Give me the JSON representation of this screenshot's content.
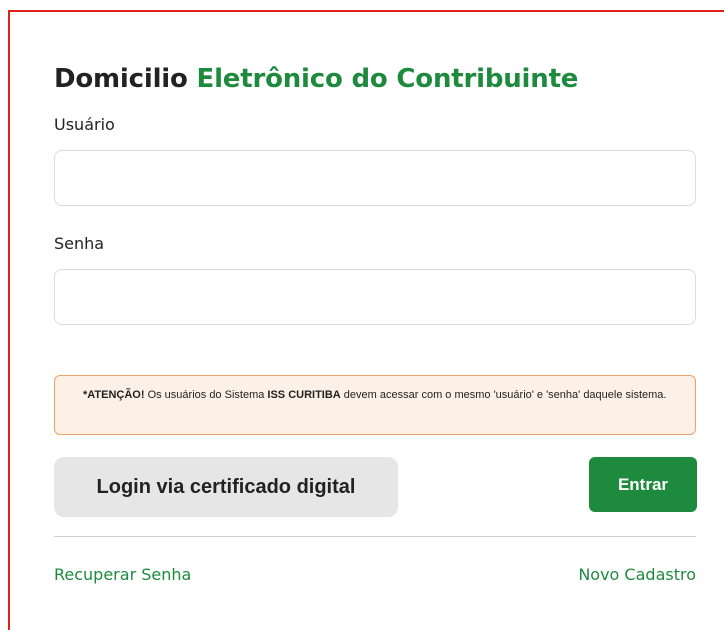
{
  "title": {
    "part1": "Domicilio ",
    "part2": "Eletrônico do Contribuinte"
  },
  "form": {
    "username_label": "Usuário",
    "username_value": "",
    "password_label": "Senha",
    "password_value": ""
  },
  "alert": {
    "prefix": "*ATENÇÃO!",
    "text1": " Os usuários do Sistema ",
    "system": "ISS CURITIBA",
    "text2": " devem acessar com o mesmo 'usuário' e 'senha' daquele sistema."
  },
  "buttons": {
    "certificate_login": "Login via certificado digital",
    "enter": "Entrar"
  },
  "links": {
    "recover_password": "Recuperar Senha",
    "new_registration": "Novo Cadastro"
  },
  "colors": {
    "brand_green": "#1e8a3e",
    "alert_border": "#f0a266",
    "alert_background": "#fdf1e7"
  }
}
